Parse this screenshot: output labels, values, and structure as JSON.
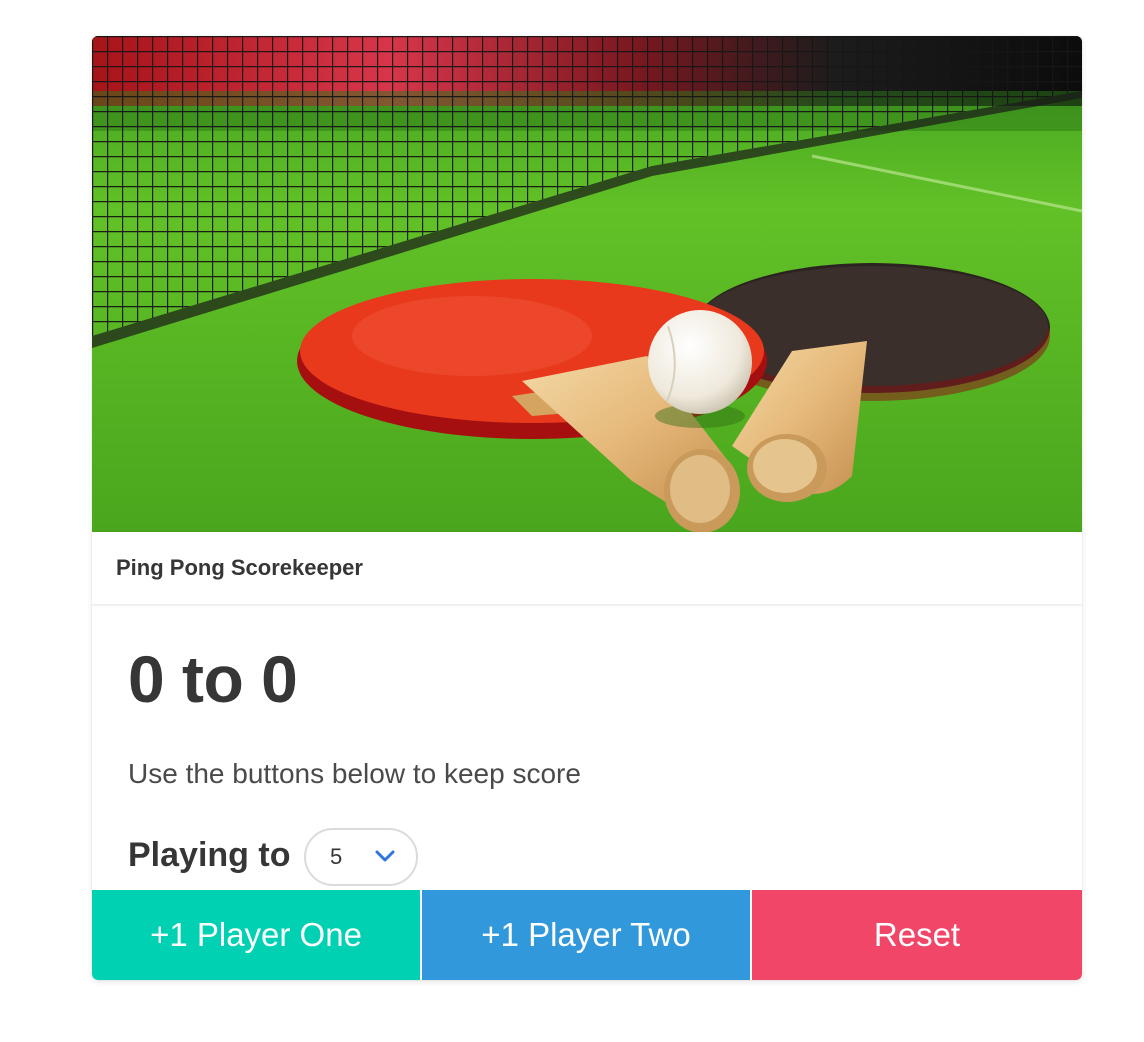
{
  "header": {
    "title": "Ping Pong Scorekeeper"
  },
  "scoreboard": {
    "player_one_score": "0",
    "separator": "to",
    "player_two_score": "0",
    "display": "0 to 0",
    "subtitle": "Use the buttons below to keep score"
  },
  "playing_to": {
    "label": "Playing to",
    "selected": "5"
  },
  "buttons": {
    "player_one": "+1 Player One",
    "player_two": "+1 Player Two",
    "reset": "Reset"
  },
  "image": {
    "subject": "ping-pong-paddles-photo"
  },
  "colors": {
    "player_one": "#00d1b2",
    "player_two": "#3298dc",
    "reset": "#f14668",
    "text": "#363636",
    "chevron": "#3273dc"
  }
}
